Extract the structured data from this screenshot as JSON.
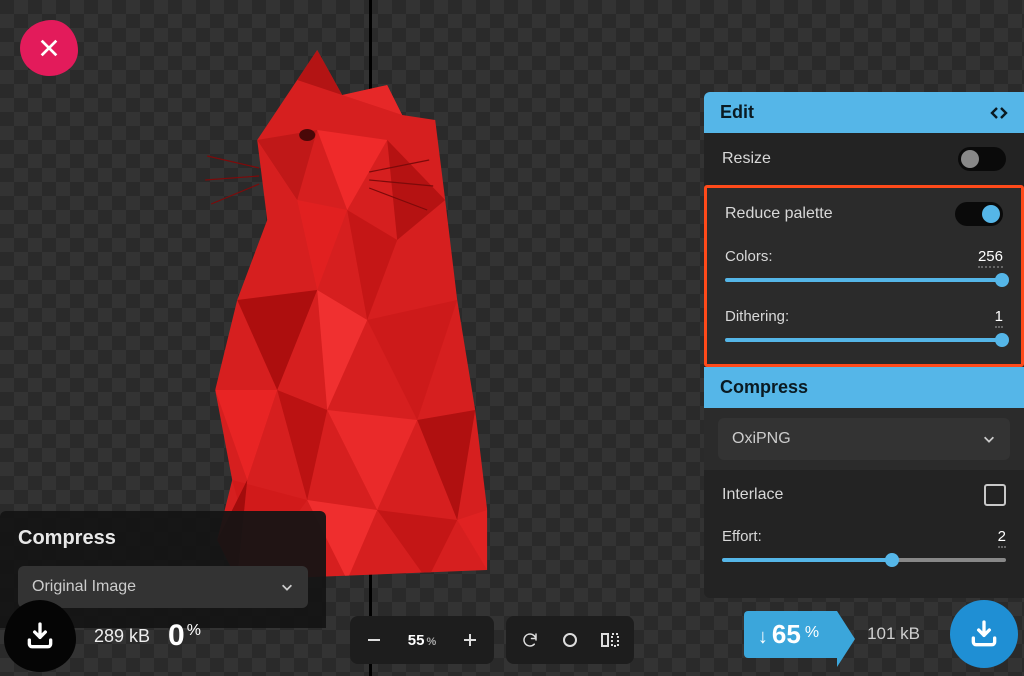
{
  "close_label": "Close",
  "left_panel": {
    "title": "Compress",
    "select_value": "Original Image",
    "size": "289 kB",
    "percent": "0"
  },
  "toolbar": {
    "zoom_value": "55",
    "zoom_unit": "%"
  },
  "right_panel": {
    "edit_title": "Edit",
    "resize_label": "Resize",
    "resize_on": false,
    "reduce_title": "Reduce palette",
    "reduce_on": true,
    "colors_label": "Colors:",
    "colors_value": "256",
    "dithering_label": "Dithering:",
    "dithering_value": "1",
    "compress_title": "Compress",
    "codec_value": "OxiPNG",
    "interlace_label": "Interlace",
    "interlace_on": false,
    "effort_label": "Effort:",
    "effort_value": "2"
  },
  "right_stats": {
    "percent": "65",
    "size": "101 kB"
  },
  "icons": {
    "compare": "compare-arrows",
    "download": "download"
  }
}
